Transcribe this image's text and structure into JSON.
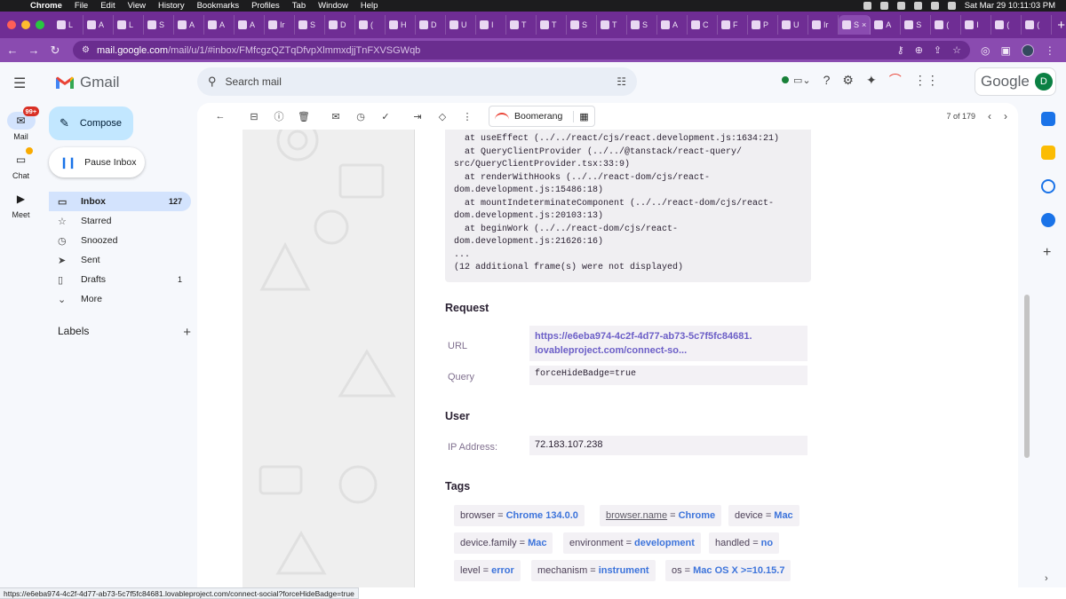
{
  "mac_menubar": {
    "app": "Chrome",
    "menus": [
      "File",
      "Edit",
      "View",
      "History",
      "Bookmarks",
      "Profiles",
      "Tab",
      "Window",
      "Help"
    ],
    "clock": "Sat Mar 29  10:11:03 PM"
  },
  "browser": {
    "tabs": [
      {
        "label": "L"
      },
      {
        "label": "A"
      },
      {
        "label": "L"
      },
      {
        "label": "S"
      },
      {
        "label": "A"
      },
      {
        "label": "A"
      },
      {
        "label": "A"
      },
      {
        "label": "Ir"
      },
      {
        "label": "S"
      },
      {
        "label": "D"
      },
      {
        "label": "("
      },
      {
        "label": "H"
      },
      {
        "label": "D"
      },
      {
        "label": "U"
      },
      {
        "label": "I"
      },
      {
        "label": "T"
      },
      {
        "label": "T"
      },
      {
        "label": "S"
      },
      {
        "label": "T"
      },
      {
        "label": "S"
      },
      {
        "label": "A"
      },
      {
        "label": "C"
      },
      {
        "label": "F"
      },
      {
        "label": "P"
      },
      {
        "label": "U"
      },
      {
        "label": "Ir"
      },
      {
        "label": "S",
        "active": true
      },
      {
        "label": "A"
      },
      {
        "label": "S"
      },
      {
        "label": "("
      },
      {
        "label": "I"
      },
      {
        "label": "("
      },
      {
        "label": "("
      }
    ],
    "url_domain": "mail.google.com",
    "url_path": "/mail/u/1/#inbox/FMfcgzQZTqDfvpXlmmxdjjTnFXVSGWqb"
  },
  "gmail": {
    "brand": "Gmail",
    "search_placeholder": "Search mail",
    "account_brand": "Google",
    "avatar_initial": "D",
    "rail": [
      {
        "label": "Mail",
        "badge": "99+",
        "icon": "mail-icon"
      },
      {
        "label": "Chat",
        "icon": "chat-icon"
      },
      {
        "label": "Meet",
        "icon": "meet-icon"
      }
    ],
    "compose_label": "Compose",
    "pause_label": "Pause Inbox",
    "folders": [
      {
        "label": "Inbox",
        "count": "127",
        "icon": "inbox-icon",
        "active": true
      },
      {
        "label": "Starred",
        "count": "",
        "icon": "star-icon"
      },
      {
        "label": "Snoozed",
        "count": "",
        "icon": "clock-icon"
      },
      {
        "label": "Sent",
        "count": "",
        "icon": "send-icon"
      },
      {
        "label": "Drafts",
        "count": "1",
        "icon": "draft-icon"
      },
      {
        "label": "More",
        "count": "",
        "icon": "chevron-down-icon"
      }
    ],
    "labels_heading": "Labels",
    "toolbar": {
      "boomerang_label": "Boomerang",
      "pager": "7 of 179"
    }
  },
  "email": {
    "stack_lines": [
      "  at useEffect (../../react/cjs/react.development.js:1634:21)",
      "  at QueryClientProvider (../../@tanstack/react-query/",
      "src/QueryClientProvider.tsx:33:9)",
      "  at renderWithHooks (../../react-dom/cjs/react-",
      "dom.development.js:15486:18)",
      "  at mountIndeterminateComponent (../../react-dom/cjs/react-",
      "dom.development.js:20103:13)",
      "  at beginWork (../../react-dom/cjs/react-",
      "dom.development.js:21626:16)",
      "...",
      "(12 additional frame(s) were not displayed)"
    ],
    "request_heading": "Request",
    "url_key": "URL",
    "url_value_line1": "https://e6eba974-4c2f-4d77-ab73-5c7f5fc84681.",
    "url_value_line2": "lovableproject.com/connect-so...",
    "query_key": "Query",
    "query_value": "forceHideBadge=true",
    "user_heading": "User",
    "ip_key": "IP Address:",
    "ip_value": "72.183.107.238",
    "tags_heading": "Tags",
    "tags": [
      {
        "key": "browser",
        "value": "Chrome 134.0.0"
      },
      {
        "key": "browser.name",
        "value": "Chrome",
        "underline": true
      },
      {
        "key": "device",
        "value": "Mac"
      },
      {
        "key": "device.family",
        "value": "Mac"
      },
      {
        "key": "environment",
        "value": "development"
      },
      {
        "key": "handled",
        "value": "no"
      },
      {
        "key": "level",
        "value": "error"
      },
      {
        "key": "mechanism",
        "value": "instrument"
      },
      {
        "key": "os",
        "value": "Mac OS X >=10.15.7"
      }
    ]
  },
  "status_bar_url": "https://e6eba974-4c2f-4d77-ab73-5c7f5fc84681.lovableproject.com/connect-social?forceHideBadge=true",
  "colors": {
    "chrome_theme": "#6f2d94",
    "accent_blue": "#3d74db",
    "compose_bg": "#c2e7ff",
    "active_folder": "#d3e3fd"
  }
}
